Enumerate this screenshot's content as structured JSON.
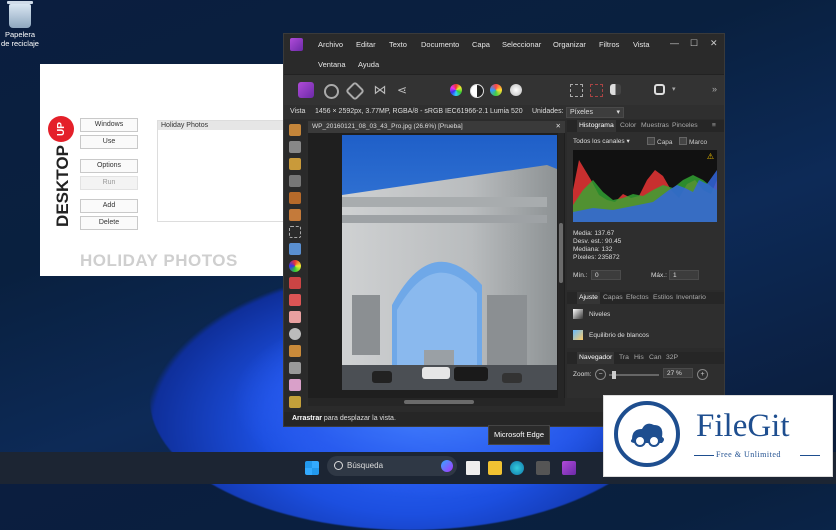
{
  "desktop": {
    "recycle_bin_label": "Papelera de reciclaje"
  },
  "desktopup": {
    "logo_badge": "UP",
    "logo_word": "DESKTOP",
    "buttons": [
      "Windows",
      "Use",
      "Options",
      "Run",
      "Add",
      "Delete"
    ],
    "list_items": [
      "Holiday Photos"
    ],
    "title": "HOLIDAY PHOTOS"
  },
  "affinity": {
    "menu": [
      "Archivo",
      "Editar",
      "Texto",
      "Documento",
      "Capa",
      "Seleccionar",
      "Organizar",
      "Filtros",
      "Vista",
      "Ventana",
      "Ayuda"
    ],
    "context": {
      "label": "Vista",
      "doc_info": "1456 × 2592px, 3.77MP, RGBA/8 - sRGB IEC61966-2.1",
      "lens": "Lumia 520",
      "units_label": "Unidades:",
      "units_value": "Píxeles"
    },
    "doc_tab": "WP_20160121_08_03_43_Pro.jpg (26.6%) [Prueba]",
    "status": {
      "bold": "Arrastrar",
      "rest": " para desplazar la vista."
    },
    "histogram_tabs": [
      "Histograma",
      "Color",
      "Muestras",
      "Pinceles"
    ],
    "histogram": {
      "channel": "Todos los canales",
      "layer_check": "Capa",
      "frame_check": "Marco",
      "stats": [
        "Media: 137.67",
        "Desv. est.: 90.45",
        "Mediana: 132",
        "Píxeles: 235872"
      ],
      "min_label": "Mín.:",
      "min_value": "0",
      "max_label": "Máx.:",
      "max_value": "1"
    },
    "adjust_tabs": [
      "Ajuste",
      "Capas",
      "Efectos",
      "Estilos",
      "Inventario"
    ],
    "adjustments": [
      "Niveles",
      "Equilibrio de blancos"
    ],
    "nav_tabs": [
      "Navegador",
      "Tra",
      "His",
      "Can",
      "32P"
    ],
    "zoom_label": "Zoom:",
    "zoom_value": "27 %"
  },
  "taskbar": {
    "search_placeholder": "Búsqueda",
    "tooltip": "Microsoft Edge"
  },
  "watermark": {
    "name": "FileGit",
    "tagline": "Free & Unlimited"
  }
}
